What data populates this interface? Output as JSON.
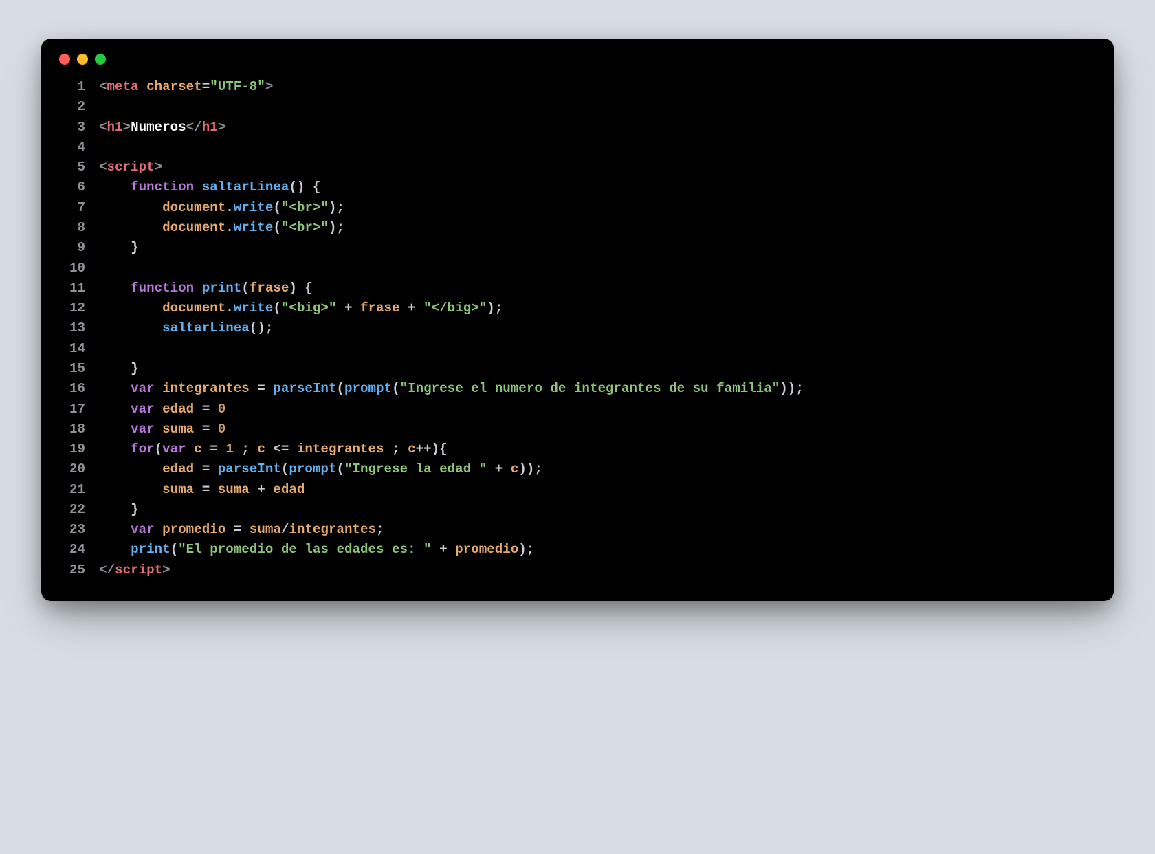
{
  "window": {
    "dots": [
      "red",
      "yellow",
      "green"
    ]
  },
  "code": {
    "lines": [
      {
        "n": 1,
        "tokens": [
          {
            "c": "t-angle",
            "t": "<"
          },
          {
            "c": "t-tag",
            "t": "meta"
          },
          {
            "c": "",
            "t": " "
          },
          {
            "c": "t-attr",
            "t": "charset"
          },
          {
            "c": "t-punct",
            "t": "="
          },
          {
            "c": "t-str",
            "t": "\"UTF-8\""
          },
          {
            "c": "t-angle",
            "t": ">"
          }
        ]
      },
      {
        "n": 2,
        "tokens": []
      },
      {
        "n": 3,
        "tokens": [
          {
            "c": "t-angle",
            "t": "<"
          },
          {
            "c": "t-tag",
            "t": "h1"
          },
          {
            "c": "t-angle",
            "t": ">"
          },
          {
            "c": "t-white",
            "t": "Numeros"
          },
          {
            "c": "t-angle",
            "t": "</"
          },
          {
            "c": "t-tag",
            "t": "h1"
          },
          {
            "c": "t-angle",
            "t": ">"
          }
        ]
      },
      {
        "n": 4,
        "tokens": []
      },
      {
        "n": 5,
        "tokens": [
          {
            "c": "t-angle",
            "t": "<"
          },
          {
            "c": "t-tag",
            "t": "script"
          },
          {
            "c": "t-angle",
            "t": ">"
          }
        ]
      },
      {
        "n": 6,
        "tokens": [
          {
            "c": "",
            "t": "    "
          },
          {
            "c": "t-kw",
            "t": "function"
          },
          {
            "c": "",
            "t": " "
          },
          {
            "c": "t-fn",
            "t": "saltarLinea"
          },
          {
            "c": "t-punct",
            "t": "() {"
          }
        ]
      },
      {
        "n": 7,
        "tokens": [
          {
            "c": "",
            "t": "        "
          },
          {
            "c": "t-ident",
            "t": "document"
          },
          {
            "c": "t-punct",
            "t": "."
          },
          {
            "c": "t-fn",
            "t": "write"
          },
          {
            "c": "t-punct",
            "t": "("
          },
          {
            "c": "t-str",
            "t": "\"<br>\""
          },
          {
            "c": "t-punct",
            "t": ");"
          }
        ]
      },
      {
        "n": 8,
        "tokens": [
          {
            "c": "",
            "t": "        "
          },
          {
            "c": "t-ident",
            "t": "document"
          },
          {
            "c": "t-punct",
            "t": "."
          },
          {
            "c": "t-fn",
            "t": "write"
          },
          {
            "c": "t-punct",
            "t": "("
          },
          {
            "c": "t-str",
            "t": "\"<br>\""
          },
          {
            "c": "t-punct",
            "t": ");"
          }
        ]
      },
      {
        "n": 9,
        "tokens": [
          {
            "c": "",
            "t": "    "
          },
          {
            "c": "t-punct",
            "t": "}"
          }
        ]
      },
      {
        "n": 10,
        "tokens": []
      },
      {
        "n": 11,
        "tokens": [
          {
            "c": "",
            "t": "    "
          },
          {
            "c": "t-kw",
            "t": "function"
          },
          {
            "c": "",
            "t": " "
          },
          {
            "c": "t-fn",
            "t": "print"
          },
          {
            "c": "t-punct",
            "t": "("
          },
          {
            "c": "t-ident",
            "t": "frase"
          },
          {
            "c": "t-punct",
            "t": ") {"
          }
        ]
      },
      {
        "n": 12,
        "tokens": [
          {
            "c": "",
            "t": "        "
          },
          {
            "c": "t-ident",
            "t": "document"
          },
          {
            "c": "t-punct",
            "t": "."
          },
          {
            "c": "t-fn",
            "t": "write"
          },
          {
            "c": "t-punct",
            "t": "("
          },
          {
            "c": "t-str",
            "t": "\"<big>\""
          },
          {
            "c": "t-punct",
            "t": " + "
          },
          {
            "c": "t-ident",
            "t": "frase"
          },
          {
            "c": "t-punct",
            "t": " + "
          },
          {
            "c": "t-str",
            "t": "\"</big>\""
          },
          {
            "c": "t-punct",
            "t": ");"
          }
        ]
      },
      {
        "n": 13,
        "tokens": [
          {
            "c": "",
            "t": "        "
          },
          {
            "c": "t-fn",
            "t": "saltarLinea"
          },
          {
            "c": "t-punct",
            "t": "();"
          }
        ]
      },
      {
        "n": 14,
        "tokens": []
      },
      {
        "n": 15,
        "tokens": [
          {
            "c": "",
            "t": "    "
          },
          {
            "c": "t-punct",
            "t": "}"
          }
        ]
      },
      {
        "n": 16,
        "tokens": [
          {
            "c": "",
            "t": "    "
          },
          {
            "c": "t-kw",
            "t": "var"
          },
          {
            "c": "",
            "t": " "
          },
          {
            "c": "t-ident",
            "t": "integrantes"
          },
          {
            "c": "t-punct",
            "t": " = "
          },
          {
            "c": "t-fn",
            "t": "parseInt"
          },
          {
            "c": "t-punct",
            "t": "("
          },
          {
            "c": "t-fn",
            "t": "prompt"
          },
          {
            "c": "t-punct",
            "t": "("
          },
          {
            "c": "t-str",
            "t": "\"Ingrese el numero de integrantes de su familia\""
          },
          {
            "c": "t-punct",
            "t": "));"
          }
        ]
      },
      {
        "n": 17,
        "tokens": [
          {
            "c": "",
            "t": "    "
          },
          {
            "c": "t-kw",
            "t": "var"
          },
          {
            "c": "",
            "t": " "
          },
          {
            "c": "t-ident",
            "t": "edad"
          },
          {
            "c": "t-punct",
            "t": " = "
          },
          {
            "c": "t-num",
            "t": "0"
          }
        ]
      },
      {
        "n": 18,
        "tokens": [
          {
            "c": "",
            "t": "    "
          },
          {
            "c": "t-kw",
            "t": "var"
          },
          {
            "c": "",
            "t": " "
          },
          {
            "c": "t-ident",
            "t": "suma"
          },
          {
            "c": "t-punct",
            "t": " = "
          },
          {
            "c": "t-num",
            "t": "0"
          }
        ]
      },
      {
        "n": 19,
        "tokens": [
          {
            "c": "",
            "t": "    "
          },
          {
            "c": "t-kw",
            "t": "for"
          },
          {
            "c": "t-punct",
            "t": "("
          },
          {
            "c": "t-kw",
            "t": "var"
          },
          {
            "c": "",
            "t": " "
          },
          {
            "c": "t-ident",
            "t": "c"
          },
          {
            "c": "t-punct",
            "t": " = "
          },
          {
            "c": "t-num",
            "t": "1"
          },
          {
            "c": "t-punct",
            "t": " ; "
          },
          {
            "c": "t-ident",
            "t": "c"
          },
          {
            "c": "t-punct",
            "t": " <= "
          },
          {
            "c": "t-ident",
            "t": "integrantes"
          },
          {
            "c": "t-punct",
            "t": " ; "
          },
          {
            "c": "t-ident",
            "t": "c"
          },
          {
            "c": "t-punct",
            "t": "++){"
          }
        ]
      },
      {
        "n": 20,
        "tokens": [
          {
            "c": "",
            "t": "        "
          },
          {
            "c": "t-ident",
            "t": "edad"
          },
          {
            "c": "t-punct",
            "t": " = "
          },
          {
            "c": "t-fn",
            "t": "parseInt"
          },
          {
            "c": "t-punct",
            "t": "("
          },
          {
            "c": "t-fn",
            "t": "prompt"
          },
          {
            "c": "t-punct",
            "t": "("
          },
          {
            "c": "t-str",
            "t": "\"Ingrese la edad \""
          },
          {
            "c": "t-punct",
            "t": " + "
          },
          {
            "c": "t-ident",
            "t": "c"
          },
          {
            "c": "t-punct",
            "t": "));"
          }
        ]
      },
      {
        "n": 21,
        "tokens": [
          {
            "c": "",
            "t": "        "
          },
          {
            "c": "t-ident",
            "t": "suma"
          },
          {
            "c": "t-punct",
            "t": " = "
          },
          {
            "c": "t-ident",
            "t": "suma"
          },
          {
            "c": "t-punct",
            "t": " + "
          },
          {
            "c": "t-ident",
            "t": "edad"
          }
        ]
      },
      {
        "n": 22,
        "tokens": [
          {
            "c": "",
            "t": "    "
          },
          {
            "c": "t-punct",
            "t": "}"
          }
        ]
      },
      {
        "n": 23,
        "tokens": [
          {
            "c": "",
            "t": "    "
          },
          {
            "c": "t-kw",
            "t": "var"
          },
          {
            "c": "",
            "t": " "
          },
          {
            "c": "t-ident",
            "t": "promedio"
          },
          {
            "c": "t-punct",
            "t": " = "
          },
          {
            "c": "t-ident",
            "t": "suma"
          },
          {
            "c": "t-punct",
            "t": "/"
          },
          {
            "c": "t-ident",
            "t": "integrantes"
          },
          {
            "c": "t-punct",
            "t": ";"
          }
        ]
      },
      {
        "n": 24,
        "tokens": [
          {
            "c": "",
            "t": "    "
          },
          {
            "c": "t-fn",
            "t": "print"
          },
          {
            "c": "t-punct",
            "t": "("
          },
          {
            "c": "t-str",
            "t": "\"El promedio de las edades es: \""
          },
          {
            "c": "t-punct",
            "t": " + "
          },
          {
            "c": "t-ident",
            "t": "promedio"
          },
          {
            "c": "t-punct",
            "t": ");"
          }
        ]
      },
      {
        "n": 25,
        "tokens": [
          {
            "c": "t-angle",
            "t": "</"
          },
          {
            "c": "t-tag",
            "t": "script"
          },
          {
            "c": "t-angle",
            "t": ">"
          }
        ]
      }
    ]
  }
}
